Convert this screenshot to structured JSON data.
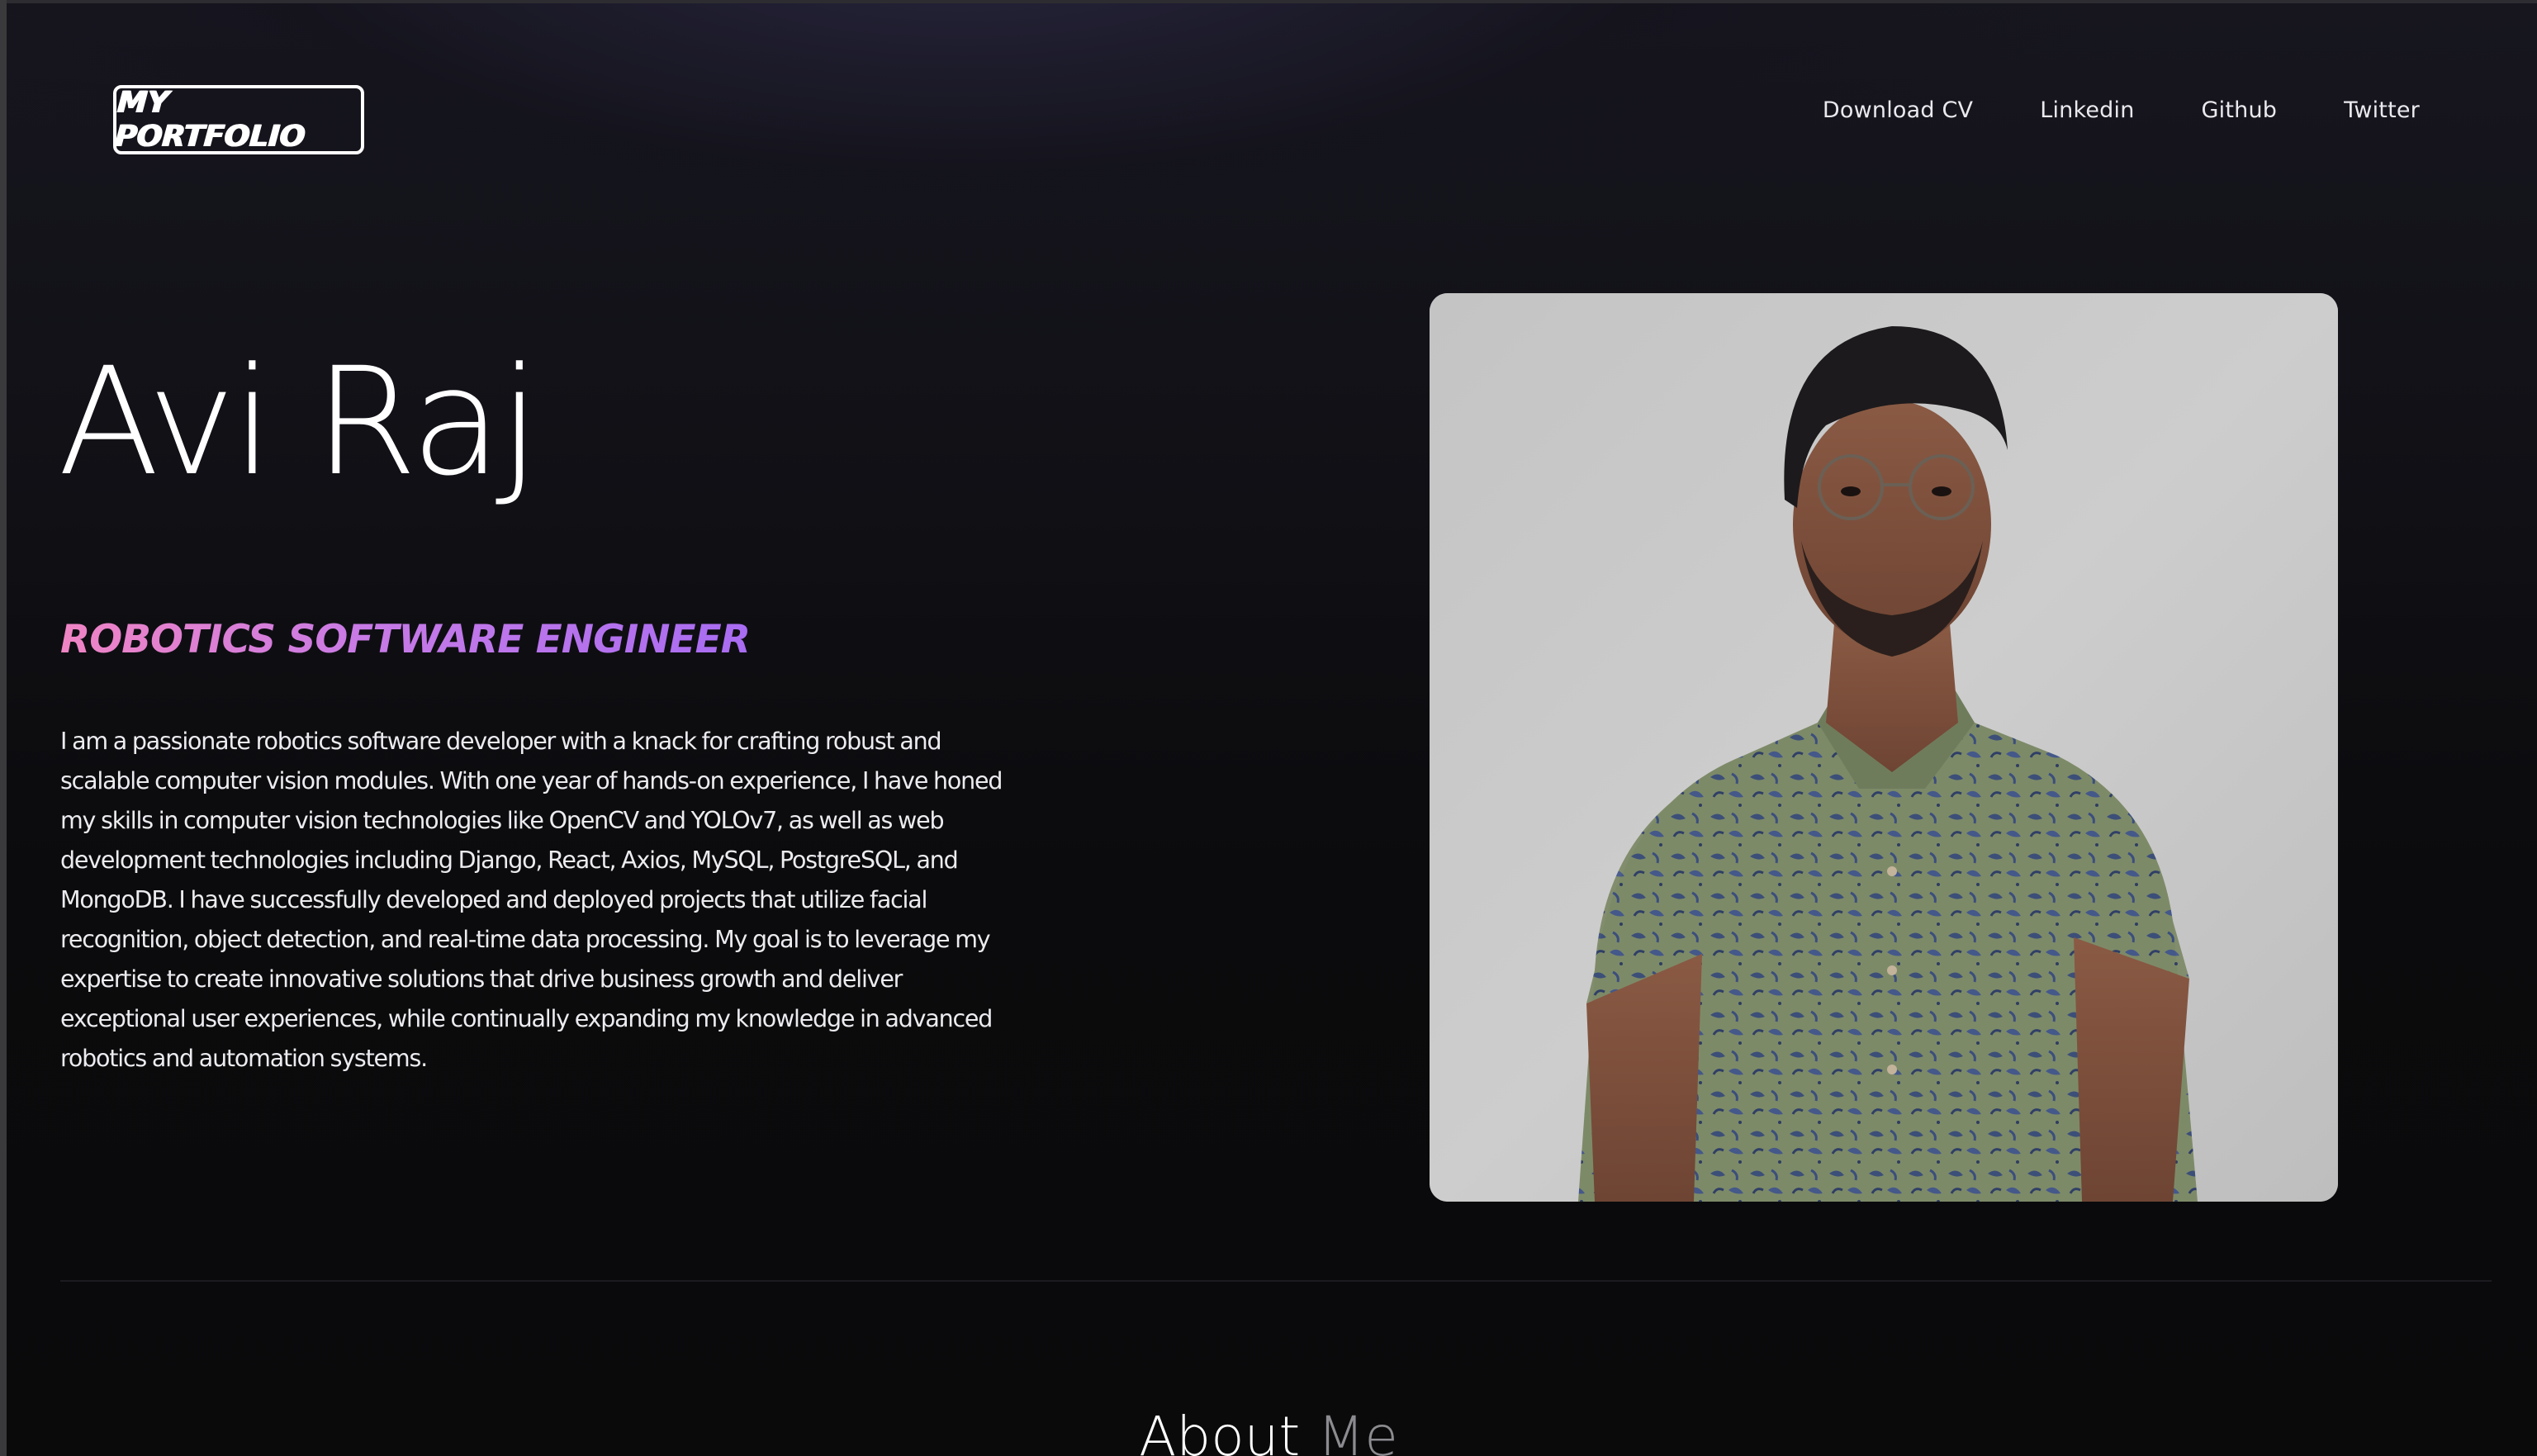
{
  "header": {
    "logo_text": "MY PORTFOLIO",
    "nav": [
      {
        "label": "Download CV"
      },
      {
        "label": "Linkedin"
      },
      {
        "label": "Github"
      },
      {
        "label": "Twitter"
      }
    ]
  },
  "hero": {
    "name": "Avi Raj",
    "role": "ROBOTICS SOFTWARE ENGINEER",
    "bio": "I am a passionate robotics software developer with a knack for crafting robust and scalable computer vision modules. With one year of hands-on experience, I have honed my skills in computer vision technologies like OpenCV and YOLOv7, as well as web development technologies including Django, React, Axios, MySQL, PostgreSQL, and MongoDB. I have successfully developed and deployed projects that utilize facial recognition, object detection, and real-time data processing. My goal is to leverage my expertise to create innovative solutions that drive business growth and deliver exceptional user experiences, while continually expanding my knowledge in advanced robotics and automation systems.",
    "photo_icon": "profile-photo"
  },
  "about": {
    "title_primary": "About",
    "title_secondary": "Me"
  },
  "colors": {
    "background": "#0b0b0d",
    "accent_gradient_start": "#f084c4",
    "accent_gradient_end": "#a86cf2",
    "text": "#ffffff"
  }
}
